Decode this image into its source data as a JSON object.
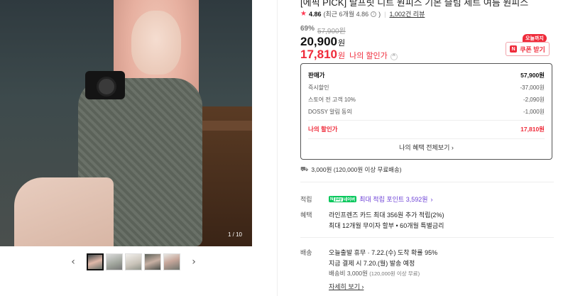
{
  "gallery": {
    "counter": "1 / 10",
    "prev_label": "‹",
    "next_label": "›",
    "thumb_count": 5
  },
  "product": {
    "title": "[에픽 PICK] 랄프릿 니트 원피스 기본 슬림 세트 여름 원피스",
    "rating": "4.86",
    "rating_note": "(최근 6개월 4.86",
    "reviews": "1,002건 리뷰",
    "discount_pct": "69%",
    "original_price": "57,900원",
    "price": "20,900",
    "price_unit": "원",
    "my_price": "17,810",
    "my_price_unit": "원",
    "my_price_label": "나의 할인가",
    "coupon_tag": "오늘까지",
    "coupon_button": "쿠폰 받기"
  },
  "breakdown": {
    "rows": [
      {
        "label": "판매가",
        "value": "57,900원"
      },
      {
        "label": "즉시할인",
        "value": "-37,000원"
      },
      {
        "label": "스토어 전 고객 10%",
        "value": "-2,090원"
      },
      {
        "label": "DOSSY 알림 동의",
        "value": "-1,000원"
      }
    ],
    "total_label": "나의 할인가",
    "total_value": "17,810원",
    "more_link": "나의 혜택 전체보기 ›"
  },
  "shipping": {
    "text": "3,000원 (120,000원 이상 무료배송)"
  },
  "points": {
    "label": "적립",
    "badge_n": "N",
    "badge_pay": "pay",
    "badge_text": "네이버",
    "text": "최대 적립 포인트 3,592원",
    "chevron": "›"
  },
  "benefit": {
    "label": "혜택",
    "line1": "라인프렌즈 카드 최대 356원 추가 적립(2%)",
    "line2": "최대 12개월 무이자 할부 • 60개월 특별금리"
  },
  "delivery": {
    "label": "배송",
    "line1": "오늘출발 휴무 · 7.22.(수) 도착 확률 95%",
    "line2": "지금 결제 시 7.20.(월) 발송 예정",
    "line3_main": "배송비 3,000원",
    "line3_small": "(120,000원 이상 무료)",
    "more": "자세히 보기 ›"
  },
  "colors": {
    "accent_red": "#ef2b3a",
    "naver_green": "#03c75a",
    "point_purple": "#6b3fd6"
  }
}
